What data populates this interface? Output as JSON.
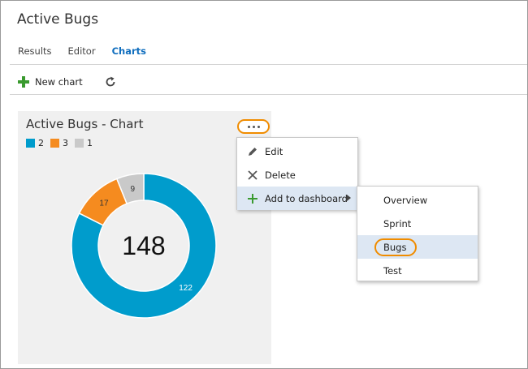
{
  "page": {
    "title": "Active Bugs"
  },
  "tabs": [
    {
      "label": "Results",
      "active": false
    },
    {
      "label": "Editor",
      "active": false
    },
    {
      "label": "Charts",
      "active": true
    }
  ],
  "toolbar": {
    "new_chart_label": "New chart",
    "new_chart_icon": "plus-icon",
    "refresh_icon": "refresh-icon"
  },
  "card": {
    "title": "Active Bugs - Chart",
    "more_icon": "ellipsis-icon",
    "legend": [
      {
        "label": "2",
        "color": "#009ccc"
      },
      {
        "label": "3",
        "color": "#f58b1f"
      },
      {
        "label": "1",
        "color": "#c9c9c9"
      }
    ],
    "total": "148"
  },
  "chart_data": {
    "type": "pie",
    "categories": [
      "2",
      "3",
      "1"
    ],
    "values": [
      122,
      17,
      9
    ],
    "colors": [
      "#009ccc",
      "#f58b1f",
      "#c9c9c9"
    ],
    "center_label": "148",
    "title": "Active Bugs - Chart",
    "legend_position": "top-left",
    "donut": true
  },
  "context_menu": {
    "items": [
      {
        "label": "Edit",
        "icon": "pencil-icon"
      },
      {
        "label": "Delete",
        "icon": "close-icon"
      },
      {
        "label": "Add to dashboard",
        "icon": "plus-icon",
        "has_submenu": true
      }
    ]
  },
  "submenu": {
    "items": [
      {
        "label": "Overview"
      },
      {
        "label": "Sprint"
      },
      {
        "label": "Bugs",
        "selected": true
      },
      {
        "label": "Test"
      }
    ]
  }
}
